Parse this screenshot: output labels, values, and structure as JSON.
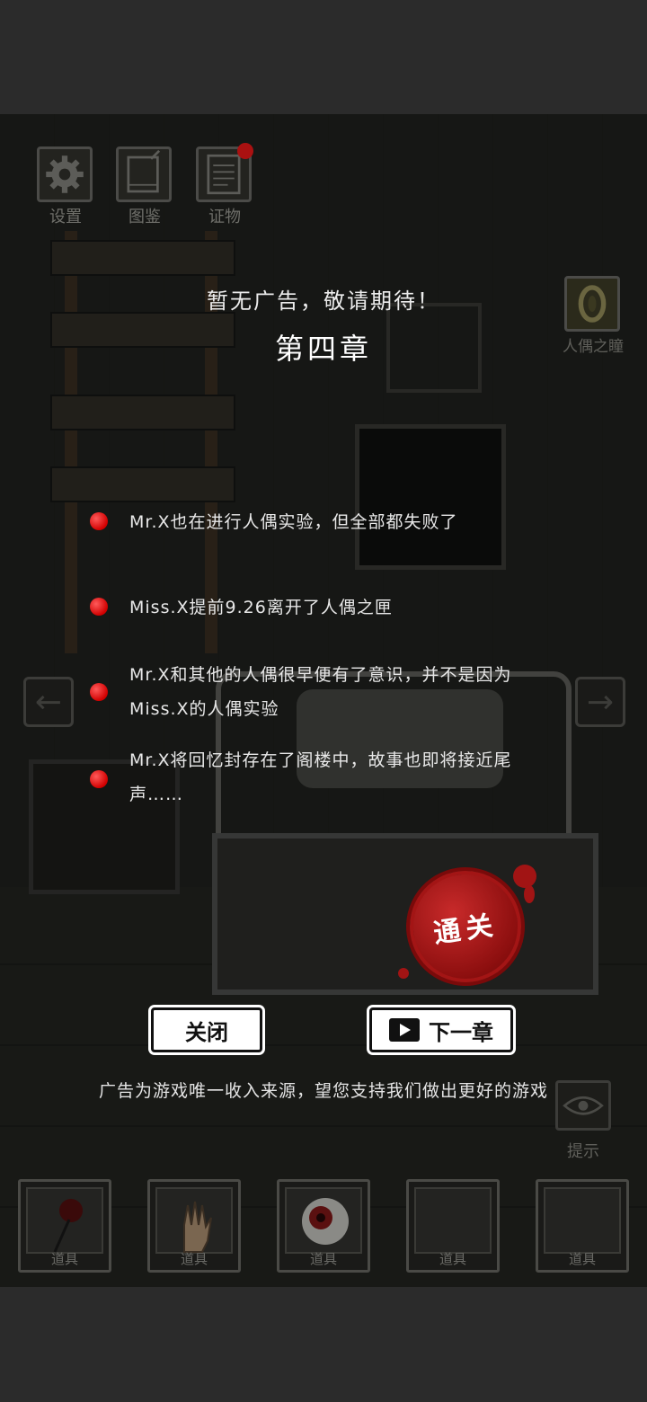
{
  "top_icons": [
    {
      "label": "设置",
      "icon": "gear-icon"
    },
    {
      "label": "图鉴",
      "icon": "book-icon"
    },
    {
      "label": "证物",
      "icon": "notepad-icon"
    }
  ],
  "side_button": {
    "label": "人偶之瞳",
    "icon": "doll-eye-icon"
  },
  "dialog": {
    "ad_notice": "暂无广告，敬请期待！",
    "chapter_title": "第四章",
    "items": [
      {
        "text": "Mr.X也在进行人偶实验，但全部都失败了"
      },
      {
        "text": "Miss.X提前9.26离开了人偶之匣"
      },
      {
        "text": "Mr.X和其他的人偶很早便有了意识，并不是因为Miss.X的人偶实验"
      },
      {
        "text": "Mr.X将回忆封存在了阁楼中，故事也即将接近尾声……"
      }
    ],
    "seal_label": "通关",
    "close_label": "关闭",
    "next_label": "下一章",
    "footer": "广告为游戏唯一收入来源，望您支持我们做出更好的游戏"
  },
  "hint": {
    "label": "提示",
    "icon": "eye-icon"
  },
  "inventory": [
    {
      "label": "道具",
      "item": "rose"
    },
    {
      "label": "道具",
      "item": "hand"
    },
    {
      "label": "道具",
      "item": "eyeball"
    },
    {
      "label": "道具",
      "item": ""
    },
    {
      "label": "道具",
      "item": ""
    }
  ],
  "colors": {
    "accent_red": "#d10000",
    "seal_red": "#8d0f0f",
    "text": "#e8e8e8"
  }
}
